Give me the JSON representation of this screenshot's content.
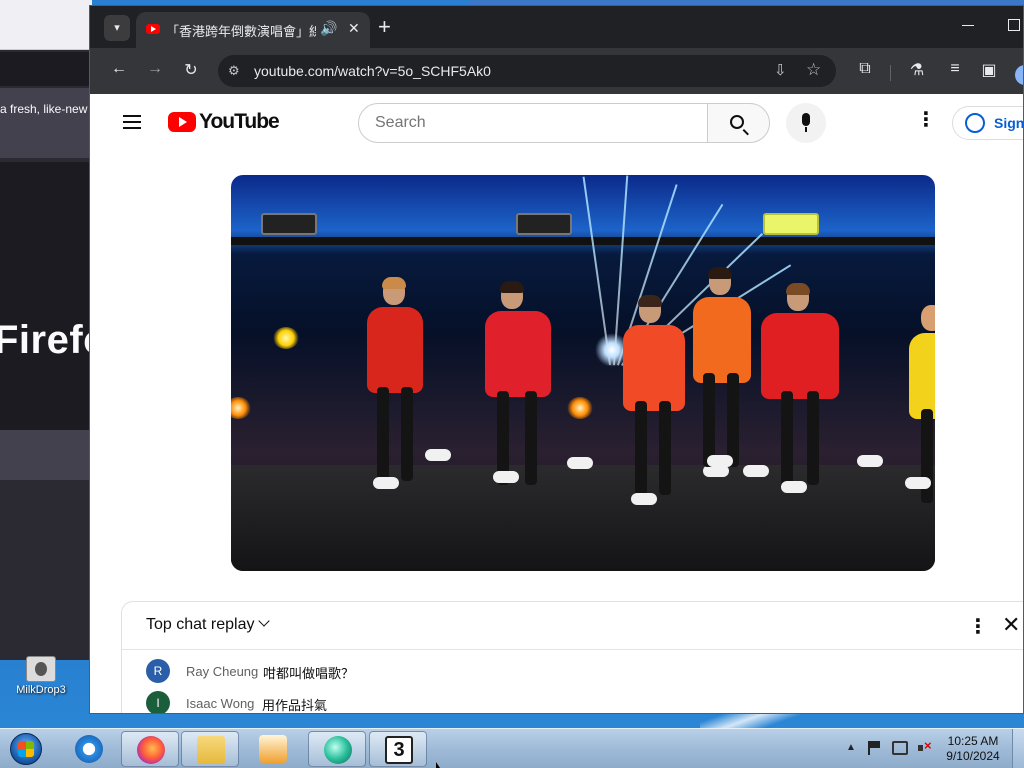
{
  "background_window": {
    "tagline": "a fresh, like-new",
    "big_text": "Firefo"
  },
  "desktop_icons": [
    {
      "label": "MilkDrop3"
    }
  ],
  "browser": {
    "tab": {
      "title": "「香港跨年倒數演唱會」線上",
      "audio_icon": "🔊",
      "close": "✕"
    },
    "new_tab": "+",
    "url": "youtube.com/watch?v=5o_SCHF5Ak0",
    "accent": "#202124"
  },
  "youtube": {
    "logo_text": "YouTube",
    "search_placeholder": "Search",
    "sign_in_label": "Sign",
    "brand_color": "#ff0000",
    "link_color": "#065fd4"
  },
  "chat": {
    "title": "Top chat replay",
    "messages": [
      {
        "avatar_letter": "R",
        "avatar_color": "#2a5ea8",
        "author": "Ray Cheung",
        "text": "咁都叫做唱歌？"
      },
      {
        "avatar_letter": "I",
        "avatar_color": "#1b5e3b",
        "author": "Isaac Wong",
        "text": "用作品抖氣"
      }
    ]
  },
  "taskbar": {
    "apps": [
      {
        "name": "internet-explorer",
        "icon": "ie-icon"
      },
      {
        "name": "firefox",
        "icon": "firefox-icon"
      },
      {
        "name": "file-explorer",
        "icon": "folder-icon"
      },
      {
        "name": "media-player",
        "icon": "media-player-icon"
      },
      {
        "name": "media-player-classic",
        "icon": "mpc-icon"
      },
      {
        "name": "app-3",
        "icon": "three-icon",
        "glyph": "3"
      }
    ],
    "clock": {
      "time": "10:25 AM",
      "date": "9/10/2024"
    }
  }
}
